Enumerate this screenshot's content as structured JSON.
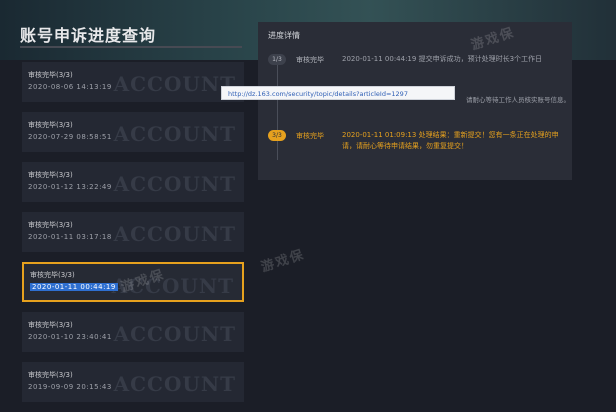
{
  "page": {
    "title": "账号申诉进度查询"
  },
  "records": [
    {
      "status": "审核完毕(3/3)",
      "date": "2020-08-06 14:13:19",
      "watermark": "ACCOUNT"
    },
    {
      "status": "审核完毕(3/3)",
      "date": "2020-07-29 08:58:51",
      "watermark": "ACCOUNT"
    },
    {
      "status": "审核完毕(3/3)",
      "date": "2020-01-12 13:22:49",
      "watermark": "ACCOUNT"
    },
    {
      "status": "审核完毕(3/3)",
      "date": "2020-01-11 03:17:18",
      "watermark": "ACCOUNT"
    },
    {
      "status": "审核完毕(3/3)",
      "date": "2020-01-11 00:44:19",
      "watermark": "ACCOUNT",
      "selected": true
    },
    {
      "status": "审核完毕(3/3)",
      "date": "2020-01-10 23:40:41",
      "watermark": "ACCOUNT"
    },
    {
      "status": "审核完毕(3/3)",
      "date": "2019-09-09 20:15:43",
      "watermark": "ACCOUNT"
    }
  ],
  "detail": {
    "title": "进度详情",
    "steps": [
      {
        "badge": "1/3",
        "status": "审核完毕",
        "text": "2020-01-11 00:44:19 提交申诉成功，预计处理时长3个工作日"
      },
      {
        "badge": "3/3",
        "status": "审核完毕",
        "text": "2020-01-11 01:09:13 处理结果：重新提交！您有一条正在处理的申请，请耐心等待申请结果，勿重复提交！"
      }
    ],
    "note": "请耐心等待工作人员核实账号信息。"
  },
  "tooltip": {
    "url": "http://dz.163.com/security/topic/details?articleId=1297"
  },
  "watermarks": {
    "brand": "游戏保"
  },
  "colors": {
    "accent": "#e6a11e",
    "selection": "#2e6fd0"
  }
}
